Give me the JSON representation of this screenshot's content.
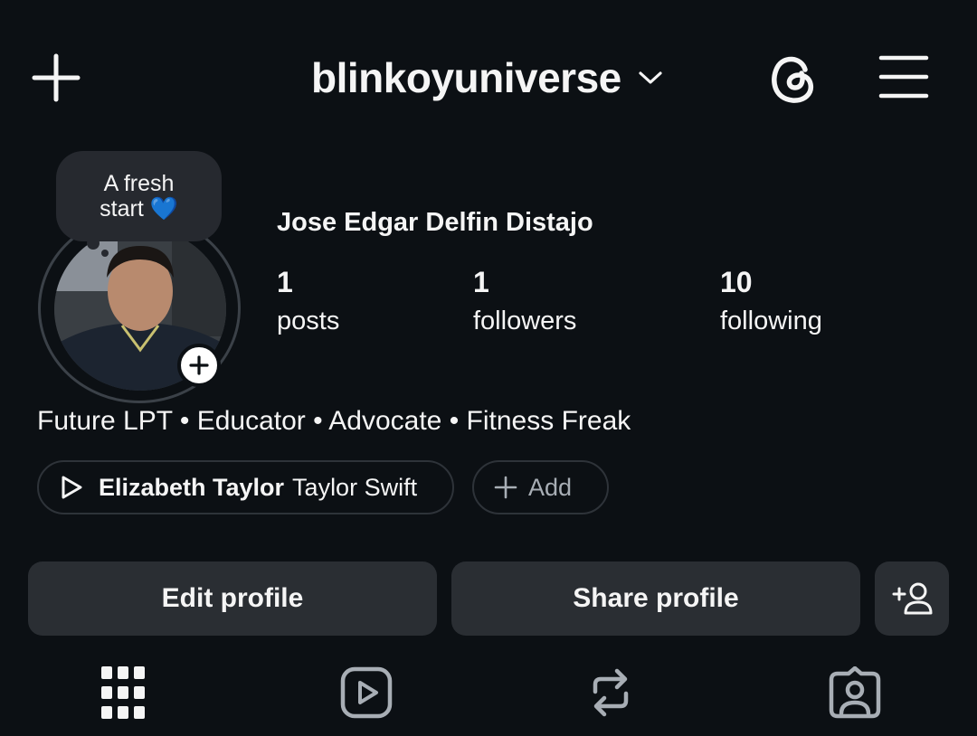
{
  "header": {
    "username": "blinkoyuniverse",
    "new_post_icon": "plus-icon",
    "account_switch_icon": "chevron-down-icon",
    "threads_icon": "threads-icon",
    "menu_icon": "hamburger-menu-icon"
  },
  "profile": {
    "note_text": "A fresh start",
    "note_emoji": "💙",
    "full_name": "Jose Edgar Delfin Distajo",
    "stats": [
      {
        "value": "1",
        "label": "posts"
      },
      {
        "value": "1",
        "label": "followers"
      },
      {
        "value": "10",
        "label": "following"
      }
    ],
    "bio": "Future LPT • Educator • Advocate • Fitness Freak",
    "music": {
      "title": "Elizabeth Taylor",
      "artist": "Taylor Swift"
    },
    "add_label": "Add"
  },
  "actions": {
    "edit_label": "Edit profile",
    "share_label": "Share profile",
    "discover_icon": "add-person-icon"
  },
  "tabs": [
    {
      "icon": "grid-icon",
      "active": true
    },
    {
      "icon": "reels-icon",
      "active": false
    },
    {
      "icon": "repost-icon",
      "active": false
    },
    {
      "icon": "tagged-icon",
      "active": false
    }
  ],
  "colors": {
    "background": "#0c1014",
    "button": "#2a2e33",
    "note_bubble": "#26292f",
    "heart": "#5bc7f5",
    "muted": "#a8aeb5"
  }
}
